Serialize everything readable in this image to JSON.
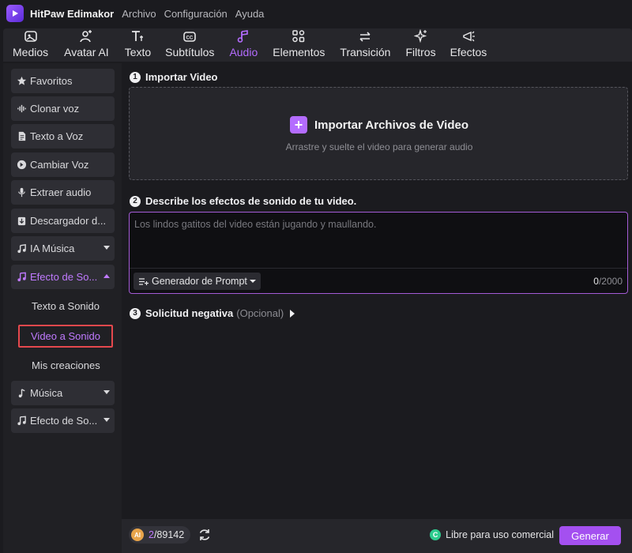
{
  "app": {
    "name": "HitPaw Edimakor",
    "menu": [
      "Archivo",
      "Configuración",
      "Ayuda"
    ]
  },
  "toolbar": {
    "tabs": [
      {
        "label": "Medios",
        "icon": "media-icon"
      },
      {
        "label": "Avatar AI",
        "icon": "avatar-icon"
      },
      {
        "label": "Texto",
        "icon": "text-icon"
      },
      {
        "label": "Subtítulos",
        "icon": "subtitles-icon"
      },
      {
        "label": "Audio",
        "icon": "audio-icon",
        "active": true
      },
      {
        "label": "Elementos",
        "icon": "elements-icon"
      },
      {
        "label": "Transición",
        "icon": "transition-icon"
      },
      {
        "label": "Filtros",
        "icon": "filters-icon"
      },
      {
        "label": "Efectos",
        "icon": "effects-icon"
      }
    ]
  },
  "sidebar": {
    "items": [
      {
        "label": "Favoritos",
        "icon": "star-icon"
      },
      {
        "label": "Clonar voz",
        "icon": "waveform-icon"
      },
      {
        "label": "Texto a Voz",
        "icon": "document-icon"
      },
      {
        "label": "Cambiar Voz",
        "icon": "voice-change-icon"
      },
      {
        "label": "Extraer audio",
        "icon": "microphone-icon"
      },
      {
        "label": "Descargador d...",
        "icon": "download-icon"
      },
      {
        "label": "IA Música",
        "icon": "ai-music-icon"
      },
      {
        "label": "Efecto de So...",
        "icon": "sound-effect-icon",
        "expanded": true
      },
      {
        "label": "Música",
        "icon": "music-note-icon"
      },
      {
        "label": "Efecto de So...",
        "icon": "sound-effect-icon"
      }
    ],
    "subitems": [
      {
        "label": "Texto a Sonido"
      },
      {
        "label": "Video a Sonido",
        "selected": true
      },
      {
        "label": "Mis creaciones"
      }
    ]
  },
  "main": {
    "step1": {
      "num": "1",
      "title": "Importar Video"
    },
    "import": {
      "label": "Importar Archivos de Video",
      "hint": "Arrastre y suelte el video para generar audio"
    },
    "step2": {
      "num": "2",
      "title": "Describe los efectos de sonido de tu video."
    },
    "prompt": {
      "placeholder": "Los lindos gatitos del video están jugando y maullando.",
      "generator_label": "Generador de Prompt",
      "count": "0",
      "max": "/2000"
    },
    "step3": {
      "num": "3",
      "title": "Solicitud negativa",
      "optional": "(Opcional)"
    }
  },
  "bottom": {
    "credits_coin": "AI",
    "credits_used": "2",
    "credits_total": "/89142",
    "commercial": "Libre para uso comercial",
    "generate": "Generar"
  },
  "colors": {
    "accent": "#b46cff",
    "button": "#a450f0",
    "selection_border": "#e5484d",
    "ok": "#2ecc8f"
  }
}
